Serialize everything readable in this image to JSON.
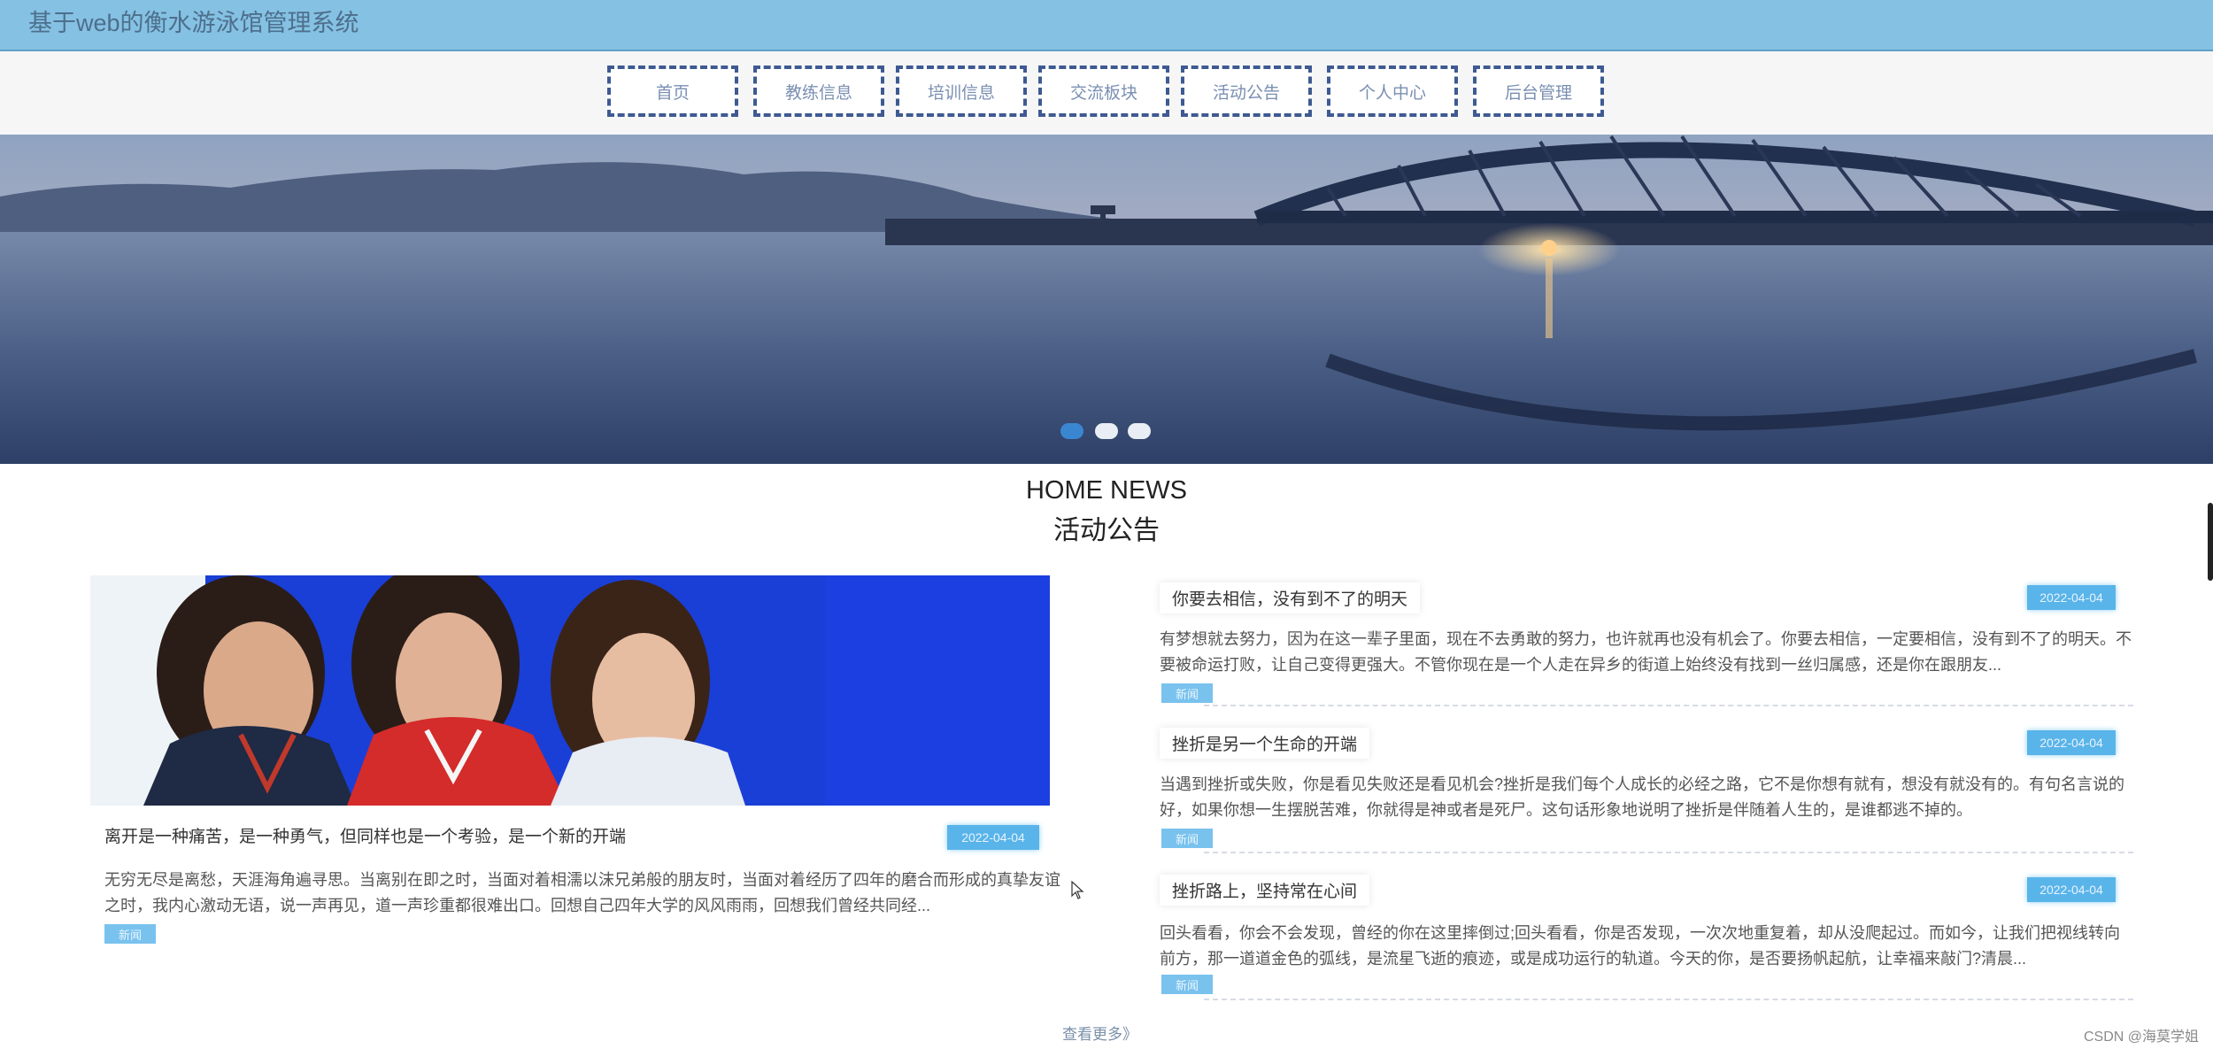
{
  "site": {
    "title": "基于web的衡水游泳馆管理系统"
  },
  "nav": {
    "items": [
      {
        "label": "首页"
      },
      {
        "label": "教练信息"
      },
      {
        "label": "培训信息"
      },
      {
        "label": "交流板块"
      },
      {
        "label": "活动公告"
      },
      {
        "label": "个人中心"
      },
      {
        "label": "后台管理"
      }
    ]
  },
  "banner": {
    "slide_count": 3,
    "active_slide": 1
  },
  "section": {
    "title_en": "HOME NEWS",
    "title_cn": "活动公告"
  },
  "featured": {
    "title": "离开是一种痛苦，是一种勇气，但同样也是一个考验，是一个新的开端",
    "date": "2022-04-04",
    "excerpt": "无穷无尽是离愁，天涯海角遍寻思。当离别在即之时，当面对着相濡以沫兄弟般的朋友时，当面对着经历了四年的磨合而形成的真挚友谊之时，我内心激动无语，说一声再见，道一声珍重都很难出口。回想自己四年大学的风风雨雨，回想我们曾经共同经...",
    "tag": "新闻"
  },
  "news": [
    {
      "title": "你要去相信，没有到不了的明天",
      "date": "2022-04-04",
      "excerpt": "有梦想就去努力，因为在这一辈子里面，现在不去勇敢的努力，也许就再也没有机会了。你要去相信，一定要相信，没有到不了的明天。不要被命运打败，让自己变得更强大。不管你现在是一个人走在异乡的街道上始终没有找到一丝归属感，还是你在跟朋友...",
      "tag": "新闻"
    },
    {
      "title": "挫折是另一个生命的开端",
      "date": "2022-04-04",
      "excerpt": "当遇到挫折或失败，你是看见失败还是看见机会?挫折是我们每个人成长的必经之路，它不是你想有就有，想没有就没有的。有句名言说的好，如果你想一生摆脱苦难，你就得是神或者是死尸。这句话形象地说明了挫折是伴随着人生的，是谁都逃不掉的。",
      "tag": "新闻"
    },
    {
      "title": "挫折路上，坚持常在心间",
      "date": "2022-04-04",
      "excerpt": "回头看看，你会不会发现，曾经的你在这里摔倒过;回头看看，你是否发现，一次次地重复着，却从没爬起过。而如今，让我们把视线转向前方，那一道道金色的弧线，是流星飞逝的痕迹，或是成功运行的轨道。今天的你，是否要扬帆起航，让幸福来敲门?清晨...",
      "tag": "新闻"
    }
  ],
  "more_link": "查看更多》",
  "credit": "CSDN @海莫学姐",
  "colors": {
    "topbar": "#85c1e3",
    "nav_border": "#3e5a92",
    "badge": "#59b4ea",
    "dot_active": "#3a86d0"
  },
  "icons": {
    "cursor": "mouse-pointer-icon"
  }
}
